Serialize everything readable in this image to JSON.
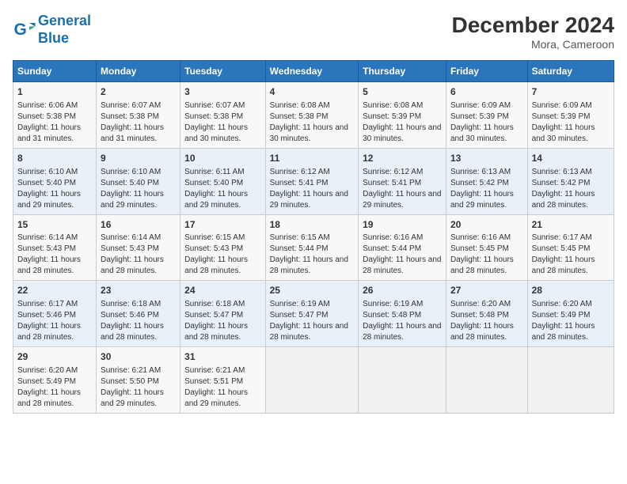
{
  "logo": {
    "line1": "General",
    "line2": "Blue"
  },
  "title": "December 2024",
  "subtitle": "Mora, Cameroon",
  "days_of_week": [
    "Sunday",
    "Monday",
    "Tuesday",
    "Wednesday",
    "Thursday",
    "Friday",
    "Saturday"
  ],
  "weeks": [
    [
      {
        "day": "1",
        "sunrise": "6:06 AM",
        "sunset": "5:38 PM",
        "daylight": "11 hours and 31 minutes."
      },
      {
        "day": "2",
        "sunrise": "6:07 AM",
        "sunset": "5:38 PM",
        "daylight": "11 hours and 31 minutes."
      },
      {
        "day": "3",
        "sunrise": "6:07 AM",
        "sunset": "5:38 PM",
        "daylight": "11 hours and 30 minutes."
      },
      {
        "day": "4",
        "sunrise": "6:08 AM",
        "sunset": "5:38 PM",
        "daylight": "11 hours and 30 minutes."
      },
      {
        "day": "5",
        "sunrise": "6:08 AM",
        "sunset": "5:39 PM",
        "daylight": "11 hours and 30 minutes."
      },
      {
        "day": "6",
        "sunrise": "6:09 AM",
        "sunset": "5:39 PM",
        "daylight": "11 hours and 30 minutes."
      },
      {
        "day": "7",
        "sunrise": "6:09 AM",
        "sunset": "5:39 PM",
        "daylight": "11 hours and 30 minutes."
      }
    ],
    [
      {
        "day": "8",
        "sunrise": "6:10 AM",
        "sunset": "5:40 PM",
        "daylight": "11 hours and 29 minutes."
      },
      {
        "day": "9",
        "sunrise": "6:10 AM",
        "sunset": "5:40 PM",
        "daylight": "11 hours and 29 minutes."
      },
      {
        "day": "10",
        "sunrise": "6:11 AM",
        "sunset": "5:40 PM",
        "daylight": "11 hours and 29 minutes."
      },
      {
        "day": "11",
        "sunrise": "6:12 AM",
        "sunset": "5:41 PM",
        "daylight": "11 hours and 29 minutes."
      },
      {
        "day": "12",
        "sunrise": "6:12 AM",
        "sunset": "5:41 PM",
        "daylight": "11 hours and 29 minutes."
      },
      {
        "day": "13",
        "sunrise": "6:13 AM",
        "sunset": "5:42 PM",
        "daylight": "11 hours and 29 minutes."
      },
      {
        "day": "14",
        "sunrise": "6:13 AM",
        "sunset": "5:42 PM",
        "daylight": "11 hours and 28 minutes."
      }
    ],
    [
      {
        "day": "15",
        "sunrise": "6:14 AM",
        "sunset": "5:43 PM",
        "daylight": "11 hours and 28 minutes."
      },
      {
        "day": "16",
        "sunrise": "6:14 AM",
        "sunset": "5:43 PM",
        "daylight": "11 hours and 28 minutes."
      },
      {
        "day": "17",
        "sunrise": "6:15 AM",
        "sunset": "5:43 PM",
        "daylight": "11 hours and 28 minutes."
      },
      {
        "day": "18",
        "sunrise": "6:15 AM",
        "sunset": "5:44 PM",
        "daylight": "11 hours and 28 minutes."
      },
      {
        "day": "19",
        "sunrise": "6:16 AM",
        "sunset": "5:44 PM",
        "daylight": "11 hours and 28 minutes."
      },
      {
        "day": "20",
        "sunrise": "6:16 AM",
        "sunset": "5:45 PM",
        "daylight": "11 hours and 28 minutes."
      },
      {
        "day": "21",
        "sunrise": "6:17 AM",
        "sunset": "5:45 PM",
        "daylight": "11 hours and 28 minutes."
      }
    ],
    [
      {
        "day": "22",
        "sunrise": "6:17 AM",
        "sunset": "5:46 PM",
        "daylight": "11 hours and 28 minutes."
      },
      {
        "day": "23",
        "sunrise": "6:18 AM",
        "sunset": "5:46 PM",
        "daylight": "11 hours and 28 minutes."
      },
      {
        "day": "24",
        "sunrise": "6:18 AM",
        "sunset": "5:47 PM",
        "daylight": "11 hours and 28 minutes."
      },
      {
        "day": "25",
        "sunrise": "6:19 AM",
        "sunset": "5:47 PM",
        "daylight": "11 hours and 28 minutes."
      },
      {
        "day": "26",
        "sunrise": "6:19 AM",
        "sunset": "5:48 PM",
        "daylight": "11 hours and 28 minutes."
      },
      {
        "day": "27",
        "sunrise": "6:20 AM",
        "sunset": "5:48 PM",
        "daylight": "11 hours and 28 minutes."
      },
      {
        "day": "28",
        "sunrise": "6:20 AM",
        "sunset": "5:49 PM",
        "daylight": "11 hours and 28 minutes."
      }
    ],
    [
      {
        "day": "29",
        "sunrise": "6:20 AM",
        "sunset": "5:49 PM",
        "daylight": "11 hours and 28 minutes."
      },
      {
        "day": "30",
        "sunrise": "6:21 AM",
        "sunset": "5:50 PM",
        "daylight": "11 hours and 29 minutes."
      },
      {
        "day": "31",
        "sunrise": "6:21 AM",
        "sunset": "5:51 PM",
        "daylight": "11 hours and 29 minutes."
      },
      null,
      null,
      null,
      null
    ]
  ],
  "labels": {
    "sunrise": "Sunrise:",
    "sunset": "Sunset:",
    "daylight": "Daylight:"
  }
}
